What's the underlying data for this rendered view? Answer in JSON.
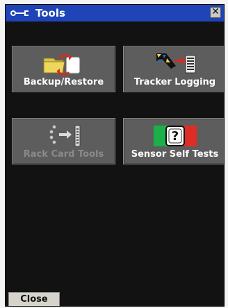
{
  "window": {
    "title": "Tools"
  },
  "tools": [
    {
      "label": "Backup/Restore",
      "icon": "backup-restore-icon",
      "enabled": true
    },
    {
      "label": "Tracker Logging",
      "icon": "tracker-logging-icon",
      "enabled": true
    },
    {
      "label": "Rack Card Tools",
      "icon": "rack-card-tools-icon",
      "enabled": false
    },
    {
      "label": "Sensor Self Tests",
      "icon": "sensor-self-tests-icon",
      "enabled": true
    }
  ],
  "footer": {
    "close_label": "Close"
  },
  "colors": {
    "titlebar": "#1f44b8",
    "window_bg": "#121212",
    "button_bg": "#5d5d5d",
    "disabled_text": "#8a8a8a"
  }
}
